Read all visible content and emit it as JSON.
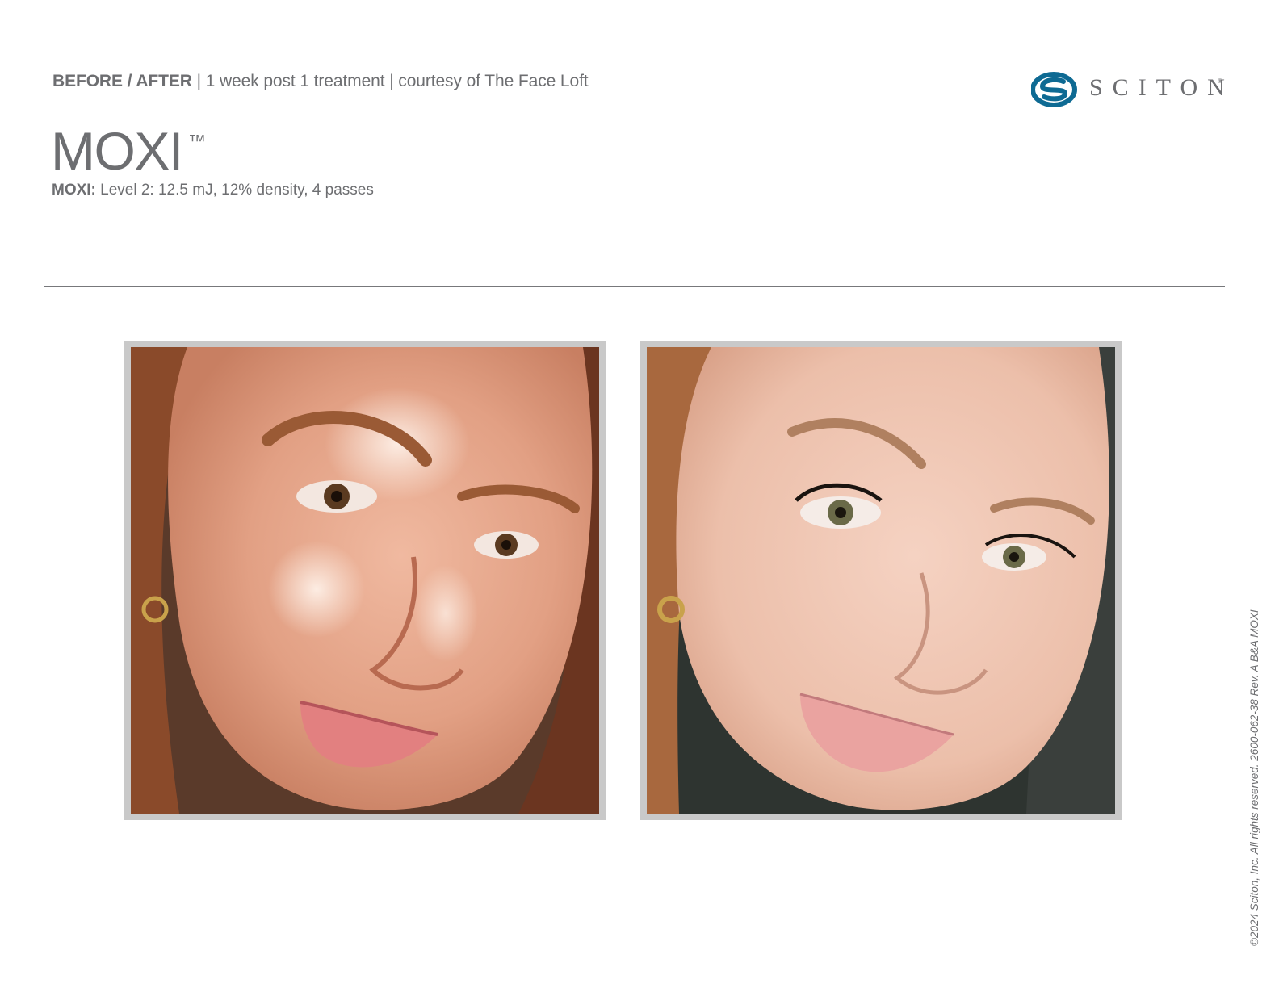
{
  "header": {
    "label": "BEFORE / AFTER",
    "details": " | 1 week post 1 treatment | courtesy of The Face Loft"
  },
  "logo": {
    "wordmark": "SCITON",
    "registered": "®",
    "colors": {
      "mark": "#0e6a93",
      "text": "#6d6e71"
    }
  },
  "product": {
    "name": "MOXI",
    "trademark": "™",
    "settings_label": "MOXI:",
    "settings_value": " Level 2: 12.5 mJ, 12% density, 4 passes"
  },
  "photos": {
    "frame_color": "#c9c9c9",
    "before": {
      "icon": "before-face-photo"
    },
    "after": {
      "icon": "after-face-photo"
    }
  },
  "footer": {
    "copyright": "©2024 Sciton, Inc. All rights reserved. 2600-062-38 Rev. A B&A MOXI"
  }
}
